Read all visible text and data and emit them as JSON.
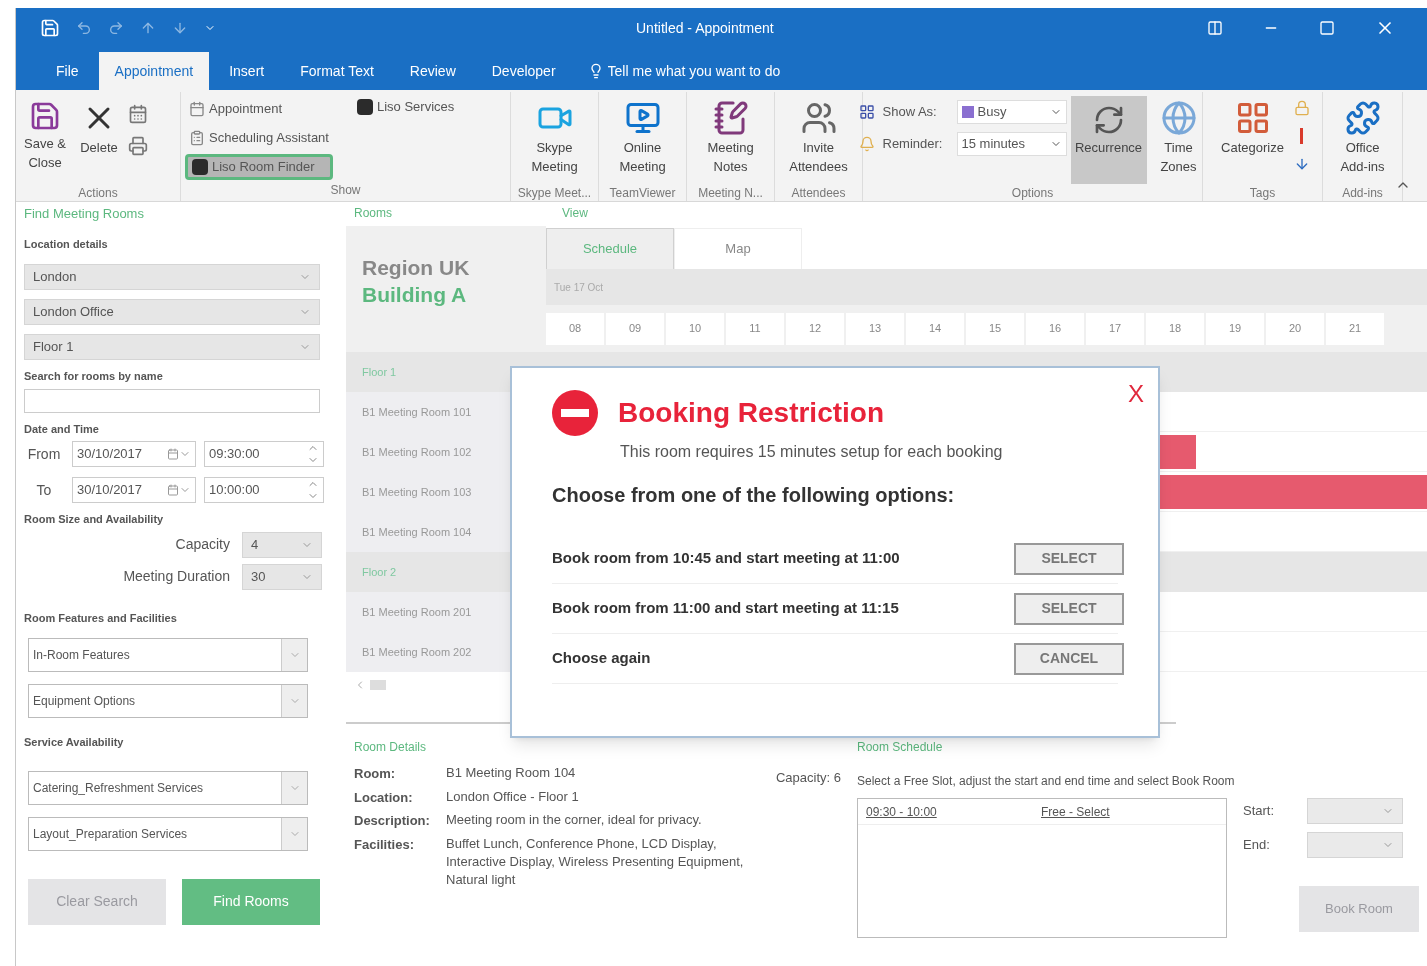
{
  "window": {
    "title": "Untitled - Appointment"
  },
  "ribbon_tabs": [
    {
      "label": "File",
      "selected": false
    },
    {
      "label": "Appointment",
      "selected": true
    },
    {
      "label": "Insert",
      "selected": false
    },
    {
      "label": "Format Text",
      "selected": false
    },
    {
      "label": "Review",
      "selected": false
    },
    {
      "label": "Developer",
      "selected": false
    }
  ],
  "tell_me": {
    "placeholder": "Tell me what you want to do"
  },
  "ribbon": {
    "actions": {
      "label": "Actions",
      "save": "Save & Close",
      "delete": "Delete"
    },
    "show": {
      "label": "Show",
      "items": [
        {
          "label": "Appointment",
          "selected": false
        },
        {
          "label": "Scheduling Assistant",
          "selected": false
        },
        {
          "label": "Liso Room Finder",
          "selected": true
        }
      ],
      "services": {
        "label": "Liso Services"
      }
    },
    "big_groups": [
      {
        "kind": "skype",
        "label": "Skype Meet...",
        "button": "Skype Meeting"
      },
      {
        "kind": "teamviewer",
        "label": "TeamViewer",
        "button": "Online Meeting"
      },
      {
        "kind": "notes",
        "label": "Meeting N...",
        "button": "Meeting Notes"
      },
      {
        "kind": "attendees",
        "label": "Attendees",
        "button": "Invite Attendees"
      }
    ],
    "options": {
      "label": "Options",
      "show_as": {
        "label": "Show As:",
        "value": "Busy"
      },
      "reminder": {
        "label": "Reminder:",
        "value": "15 minutes"
      },
      "recurrence": {
        "label": "Recurrence",
        "selected": true
      },
      "time_zones": {
        "label": "Time Zones"
      }
    },
    "tags": {
      "label": "Tags",
      "button": "Categorize"
    },
    "addins": {
      "label": "Add-ins",
      "button": "Office Add-ins"
    }
  },
  "finder": {
    "title": "Find Meeting Rooms",
    "location_label": "Location details",
    "location": [
      "London",
      "London Office",
      "Floor 1"
    ],
    "search": {
      "label": "Search for rooms by name"
    },
    "datetime": {
      "label": "Date and Time",
      "rows": [
        {
          "label": "From",
          "date": "30/10/2017",
          "time": "09:30:00"
        },
        {
          "label": "To",
          "date": "30/10/2017",
          "time": "10:00:00"
        }
      ]
    },
    "size": {
      "label": "Room Size and Availability",
      "capacity": {
        "label": "Capacity",
        "value": "4"
      },
      "duration": {
        "label": "Meeting Duration",
        "value": "30"
      }
    },
    "features": {
      "label": "Room Features and Facilities",
      "options": [
        "In-Room Features",
        "Equipment Options"
      ]
    },
    "services": {
      "label": "Service Availability",
      "options": [
        "Catering_Refreshment Services",
        "Layout_Preparation Services"
      ]
    },
    "buttons": [
      {
        "label": "Clear Search",
        "disabled": true
      },
      {
        "label": "Find Rooms",
        "disabled": false
      }
    ]
  },
  "rooms": {
    "title": "Rooms",
    "region": "Region UK",
    "building": "Building A",
    "groups": [
      {
        "label": "Floor 1",
        "rooms": [
          {
            "name": "B1 Meeting Room 101",
            "booked": false
          },
          {
            "name": "B1 Meeting Room 102",
            "booked": true,
            "runs_past_view": false
          },
          {
            "name": "B1 Meeting Room 103",
            "booked": true,
            "runs_past_view": true
          },
          {
            "name": "B1 Meeting Room 104",
            "booked": false
          }
        ]
      },
      {
        "label": "Floor 2",
        "rooms": [
          {
            "name": "B1 Meeting Room 201",
            "booked": false
          },
          {
            "name": "B1 Meeting Room 202",
            "booked": false
          }
        ]
      }
    ]
  },
  "view": {
    "title": "View",
    "tabs": [
      {
        "label": "Schedule",
        "selected": true
      },
      {
        "label": "Map",
        "selected": false
      }
    ],
    "date": "Tue 17 Oct",
    "hours": [
      "08",
      "09",
      "10",
      "11",
      "12",
      "13",
      "14",
      "15",
      "16",
      "17",
      "18",
      "19",
      "20",
      "21"
    ]
  },
  "dialog": {
    "title": "Booking Restriction",
    "close": "X",
    "message": "This room requires 15 minutes setup for each booking",
    "prompt": "Choose from one of the following options:",
    "options": [
      {
        "label": "Book room from 10:45 and start meeting at 11:00",
        "button": "SELECT"
      },
      {
        "label": "Book room from 11:00 and start meeting at 11:15",
        "button": "SELECT"
      },
      {
        "label": "Choose again",
        "button": "CANCEL"
      }
    ]
  },
  "room_details": {
    "title": "Room Details",
    "capacity": "Capacity: 6",
    "fields": [
      {
        "label": "Room:",
        "value": "B1 Meeting Room 104"
      },
      {
        "label": "Location:",
        "value": "London Office - Floor 1"
      },
      {
        "label": "Description:",
        "value": "Meeting room in the corner, ideal for privacy."
      },
      {
        "label": "Facilities:",
        "value": "Buffet Lunch, Conference Phone, LCD Display, Interactive Display, Wireless Presenting Equipment, Natural light"
      }
    ]
  },
  "room_schedule": {
    "title": "Room Schedule",
    "instruction": "Select a Free Slot, adjust the start and end time and select Book Room",
    "slots": [
      {
        "time": "09:30 - 10:00",
        "status": "Free - Select"
      }
    ],
    "start_label": "Start:",
    "end_label": "End:",
    "book": {
      "label": "Book Room",
      "disabled": true
    }
  }
}
